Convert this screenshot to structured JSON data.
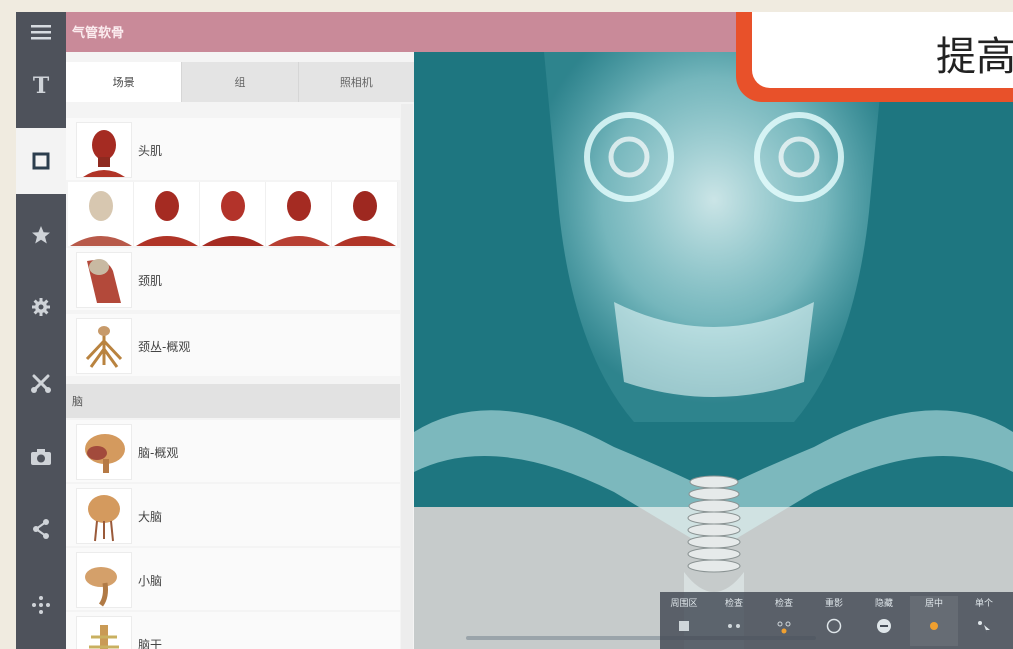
{
  "header": {
    "title": "气管软骨"
  },
  "callout": {
    "text": "提高"
  },
  "sidebar": {
    "items": [
      {
        "icon": "menu-icon",
        "active": false
      },
      {
        "icon": "text-icon",
        "active": false
      },
      {
        "icon": "square-icon",
        "active": true
      },
      {
        "icon": "star-icon",
        "active": false
      },
      {
        "icon": "gear-icon",
        "active": false
      },
      {
        "icon": "scissors-icon",
        "active": false
      },
      {
        "icon": "camera-icon",
        "active": false
      },
      {
        "icon": "share-icon",
        "active": false
      },
      {
        "icon": "move-icon",
        "active": false
      }
    ]
  },
  "panel": {
    "tabs": [
      {
        "label": "场景",
        "active": true
      },
      {
        "label": "组",
        "active": false
      },
      {
        "label": "照相机",
        "active": false
      }
    ],
    "rows": [
      {
        "label": "头肌"
      },
      {
        "label": "颈肌"
      },
      {
        "label": "颈丛-概观"
      }
    ],
    "section_label": "脑",
    "brain_rows": [
      {
        "label": "脑-概观"
      },
      {
        "label": "大脑"
      },
      {
        "label": "小脑"
      },
      {
        "label": "脑干"
      }
    ]
  },
  "toolbar": {
    "tools": [
      {
        "label": "周围区",
        "icon": "region-icon"
      },
      {
        "label": "检查",
        "icon": "inspect-icon"
      },
      {
        "label": "检查",
        "icon": "inspect-dots-icon"
      },
      {
        "label": "重影",
        "icon": "ghost-icon"
      },
      {
        "label": "隐藏",
        "icon": "hide-icon"
      },
      {
        "label": "居中",
        "icon": "center-icon"
      },
      {
        "label": "单个",
        "icon": "single-select-icon"
      }
    ]
  },
  "colors": {
    "header": "#c98a99",
    "rail": "#4e525b",
    "viewer": "#1e7680",
    "accent": "#e8512a",
    "toolbar_active": "#f0a030"
  }
}
